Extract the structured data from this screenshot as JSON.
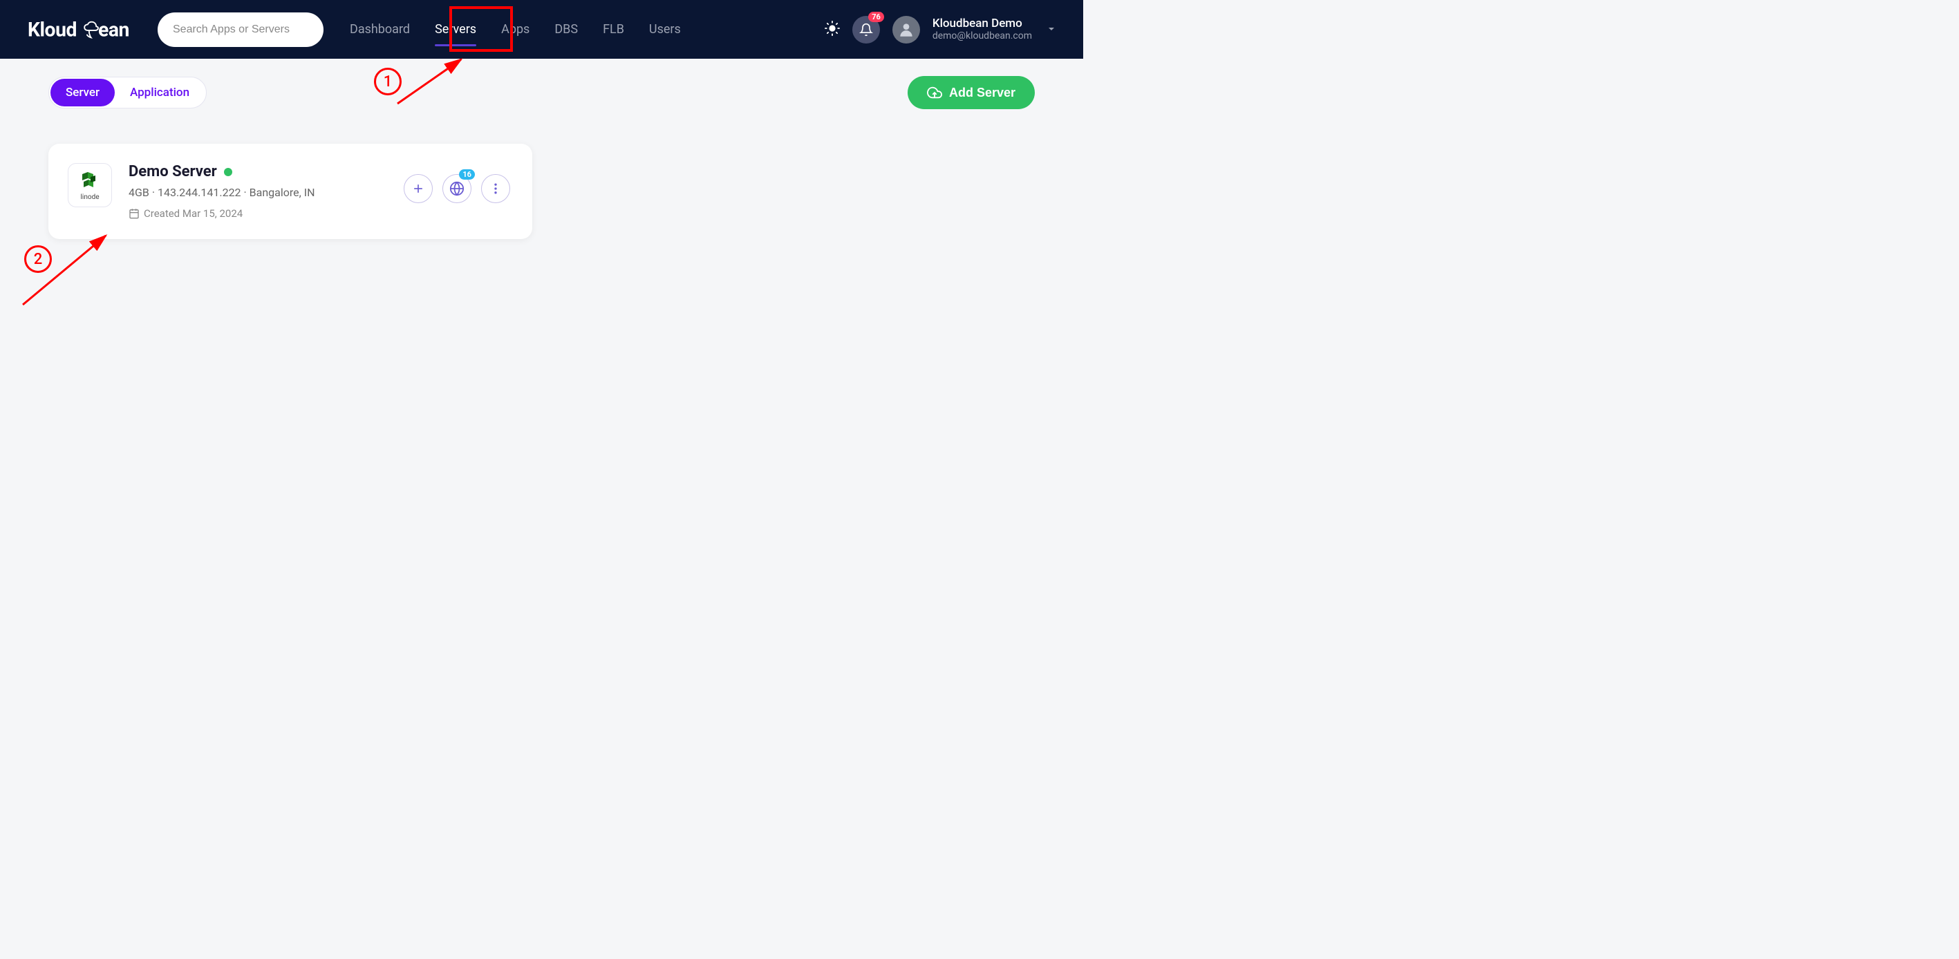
{
  "header": {
    "logo_text": "Kloudbean",
    "search_placeholder": "Search Apps or Servers",
    "nav": [
      {
        "label": "Dashboard",
        "active": false
      },
      {
        "label": "Servers",
        "active": true
      },
      {
        "label": "Apps",
        "active": false
      },
      {
        "label": "DBS",
        "active": false
      },
      {
        "label": "FLB",
        "active": false
      },
      {
        "label": "Users",
        "active": false
      }
    ],
    "notification_count": "76",
    "user_name": "Kloudbean Demo",
    "user_email": "demo@kloudbean.com"
  },
  "toggle": {
    "server_label": "Server",
    "application_label": "Application"
  },
  "add_server_label": "Add Server",
  "server": {
    "provider": "linode",
    "name": "Demo Server",
    "ram": "4GB",
    "ip": "143.244.141.222",
    "location": "Bangalore, IN",
    "created_label": "Created Mar 15, 2024",
    "app_count": "16"
  },
  "annotations": {
    "step1": "1",
    "step2": "2"
  }
}
